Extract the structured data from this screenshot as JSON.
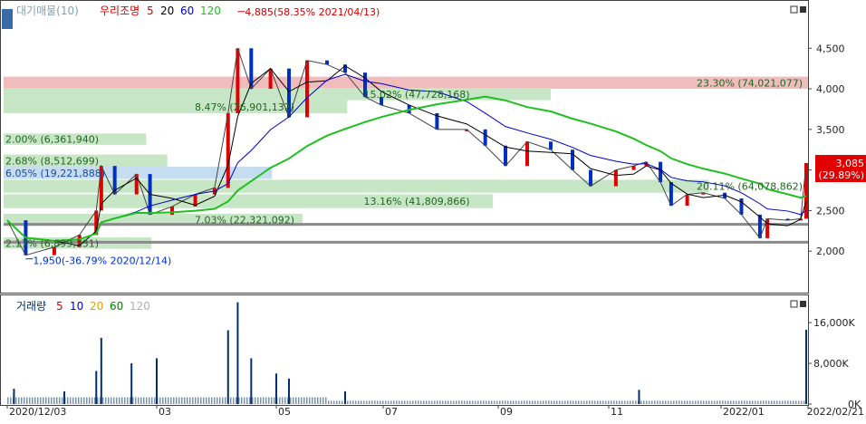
{
  "chart_data": {
    "type": "candlestick",
    "price_panel": {
      "legend": [
        {
          "label": "대기매물(10)",
          "color": "#7fa0b0"
        },
        {
          "label": "우리조명",
          "color": "#d20000"
        },
        {
          "label": "5",
          "color": "#d20000"
        },
        {
          "label": "20",
          "color": "#000000"
        },
        {
          "label": "60",
          "color": "#0000c8"
        },
        {
          "label": "120",
          "color": "#20c020"
        }
      ],
      "y_ticks": [
        {
          "value": 2000,
          "label": "2,000"
        },
        {
          "value": 2500,
          "label": "2,500"
        },
        {
          "value": 3000,
          "label": "3,000"
        },
        {
          "value": 3500,
          "label": "3,500"
        },
        {
          "value": 4000,
          "label": "4,000"
        },
        {
          "value": 4500,
          "label": "4,500"
        }
      ],
      "ylim": [
        1500,
        5050
      ],
      "price_bands": [
        {
          "low": 4000,
          "high": 4150,
          "label": "23.30% (74,021,077)",
          "pct": 23.3,
          "color": "#f0bcbc",
          "label_at": "right"
        },
        {
          "low": 3860,
          "high": 4010,
          "label": "15.02% (47,728,168)",
          "pct": 15.02,
          "color": "#c6e6c6",
          "label_at": "center"
        },
        {
          "low": 3700,
          "high": 3860,
          "label": "8.47% (26,901,132)",
          "pct": 8.47,
          "color": "#c6e6c6",
          "label_at": "center"
        },
        {
          "low": 3310,
          "high": 3450,
          "label": "2.00% (6,361,940)",
          "pct": 2.0,
          "color": "#c6e6c6",
          "label_at": "left"
        },
        {
          "low": 3040,
          "high": 3190,
          "label": "2.68% (8,512,699)",
          "pct": 2.68,
          "color": "#c6e6c6",
          "label_at": "left"
        },
        {
          "low": 2890,
          "high": 3040,
          "label": "6.05% (19,221,888)",
          "pct": 6.05,
          "color": "#c6dcf0",
          "label_at": "left"
        },
        {
          "low": 2720,
          "high": 2880,
          "label": "20.11% (64,078,862)",
          "pct": 20.11,
          "color": "#c6e6c6",
          "label_at": "right"
        },
        {
          "low": 2530,
          "high": 2700,
          "label": "13.16% (41,809,866)",
          "pct": 13.16,
          "color": "#c6e6c6",
          "label_at": "center"
        },
        {
          "low": 2310,
          "high": 2460,
          "label": "7.03% (22,321,092)",
          "pct": 7.03,
          "color": "#c6e6c6",
          "label_at": "center"
        },
        {
          "low": 2030,
          "high": 2170,
          "label": "2.17% (6,899,331)",
          "pct": 2.17,
          "color": "#c6e6c6",
          "label_at": "left"
        }
      ],
      "horizontal_lines": [
        2330,
        2110
      ],
      "annotations": [
        {
          "label": "4,885(58.35% 2021/04/13)",
          "date": "2021-04-13",
          "value": 4885,
          "kind": "high"
        },
        {
          "label": "1,950(-36.79% 2020/12/14)",
          "date": "2020-12-14",
          "value": 1950,
          "kind": "low"
        }
      ],
      "current_price": {
        "label": "3,085",
        "change": "(29.89%)",
        "value": 3085
      },
      "close_series": [
        {
          "date": "2020-12-03",
          "close": 2380
        },
        {
          "date": "2020-12-14",
          "close": 1950
        },
        {
          "date": "2020-12-31",
          "close": 2050
        },
        {
          "date": "2021-01-15",
          "close": 2200
        },
        {
          "date": "2021-01-25",
          "close": 2500
        },
        {
          "date": "2021-01-28",
          "close": 3050
        },
        {
          "date": "2021-02-05",
          "close": 2700
        },
        {
          "date": "2021-02-18",
          "close": 2950
        },
        {
          "date": "2021-02-26",
          "close": 2450
        },
        {
          "date": "2021-03-10",
          "close": 2550
        },
        {
          "date": "2021-03-22",
          "close": 2700
        },
        {
          "date": "2021-04-01",
          "close": 2780
        },
        {
          "date": "2021-04-08",
          "close": 3700
        },
        {
          "date": "2021-04-13",
          "close": 4500
        },
        {
          "date": "2021-04-20",
          "close": 4000
        },
        {
          "date": "2021-04-30",
          "close": 4250
        },
        {
          "date": "2021-05-10",
          "close": 3650
        },
        {
          "date": "2021-05-20",
          "close": 4350
        },
        {
          "date": "2021-05-31",
          "close": 4300
        },
        {
          "date": "2021-06-10",
          "close": 4200
        },
        {
          "date": "2021-06-21",
          "close": 3900
        },
        {
          "date": "2021-06-30",
          "close": 3800
        },
        {
          "date": "2021-07-15",
          "close": 3700
        },
        {
          "date": "2021-07-30",
          "close": 3500
        },
        {
          "date": "2021-08-15",
          "close": 3500
        },
        {
          "date": "2021-08-25",
          "close": 3300
        },
        {
          "date": "2021-09-05",
          "close": 3050
        },
        {
          "date": "2021-09-17",
          "close": 3350
        },
        {
          "date": "2021-09-30",
          "close": 3250
        },
        {
          "date": "2021-10-12",
          "close": 3000
        },
        {
          "date": "2021-10-22",
          "close": 2800
        },
        {
          "date": "2021-11-05",
          "close": 3000
        },
        {
          "date": "2021-11-15",
          "close": 3050
        },
        {
          "date": "2021-11-22",
          "close": 3100
        },
        {
          "date": "2021-11-30",
          "close": 2850
        },
        {
          "date": "2021-12-06",
          "close": 2560
        },
        {
          "date": "2021-12-15",
          "close": 2700
        },
        {
          "date": "2021-12-24",
          "close": 2720
        },
        {
          "date": "2022-01-05",
          "close": 2650
        },
        {
          "date": "2022-01-14",
          "close": 2450
        },
        {
          "date": "2022-01-24",
          "close": 2160
        },
        {
          "date": "2022-01-28",
          "close": 2400
        },
        {
          "date": "2022-02-08",
          "close": 2380
        },
        {
          "date": "2022-02-15",
          "close": 2400
        },
        {
          "date": "2022-02-18",
          "close": 3085
        }
      ]
    },
    "volume_panel": {
      "legend": [
        {
          "label": "거래량",
          "color": "#003060"
        },
        {
          "label": "5",
          "color": "#d20000"
        },
        {
          "label": "10",
          "color": "#0000c8"
        },
        {
          "label": "20",
          "color": "#e0a000"
        },
        {
          "label": "60",
          "color": "#008000"
        },
        {
          "label": "120",
          "color": "#b0b0b0"
        }
      ],
      "y_ticks": [
        {
          "value": 0,
          "label": "0K"
        },
        {
          "value": 8000,
          "label": "8,000K"
        },
        {
          "value": 16000,
          "label": "16,000K"
        }
      ],
      "ylim": [
        0,
        21000
      ],
      "spikes": [
        {
          "date": "2020-12-07",
          "value": 3000
        },
        {
          "date": "2021-01-06",
          "value": 2500
        },
        {
          "date": "2021-01-25",
          "value": 6500
        },
        {
          "date": "2021-01-28",
          "value": 13000
        },
        {
          "date": "2021-02-15",
          "value": 8000
        },
        {
          "date": "2021-03-02",
          "value": 9000
        },
        {
          "date": "2021-04-08",
          "value": 14500
        },
        {
          "date": "2021-04-13",
          "value": 20000
        },
        {
          "date": "2021-04-20",
          "value": 9000
        },
        {
          "date": "2021-05-03",
          "value": 6000
        },
        {
          "date": "2021-05-10",
          "value": 5000
        },
        {
          "date": "2021-06-10",
          "value": 2500
        },
        {
          "date": "2021-11-18",
          "value": 2800
        },
        {
          "date": "2022-02-18",
          "value": 14600
        }
      ]
    },
    "x_axis": {
      "tick_labels": [
        {
          "label": "2020/12/03",
          "date": "2020-12-03"
        },
        {
          "label": "03",
          "date": "2021-03-02"
        },
        {
          "label": "05",
          "date": "2021-05-03"
        },
        {
          "label": "07",
          "date": "2021-07-01"
        },
        {
          "label": "09",
          "date": "2021-09-01"
        },
        {
          "label": "11",
          "date": "2021-11-01"
        },
        {
          "label": "2022/01",
          "date": "2022-01-03"
        },
        {
          "label": "2022/02/21",
          "date": "2022-02-21"
        }
      ]
    }
  }
}
